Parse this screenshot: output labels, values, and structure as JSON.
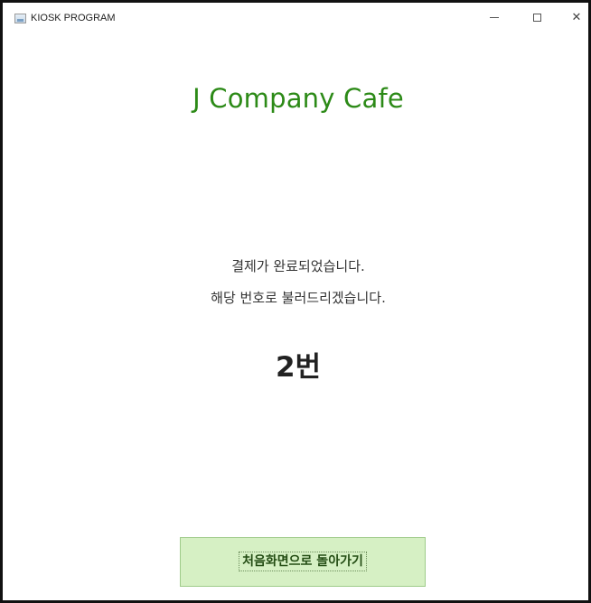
{
  "window": {
    "title": "KIOSK PROGRAM",
    "controls": {
      "minimize": "minimize",
      "maximize": "maximize",
      "close": "close"
    }
  },
  "header": {
    "cafe_name": "J Company Cafe"
  },
  "main": {
    "message_line1": "결제가 완료되었습니다.",
    "message_line2": "해당 번호로 불러드리겠습니다.",
    "order_number": "2번"
  },
  "footer": {
    "home_button_label": "처음화면으로 돌아가기"
  },
  "colors": {
    "title_green": "#2c8a17",
    "button_bg": "#d6f0c4",
    "button_border": "#9fcb8a",
    "text_dark": "#333333"
  },
  "icons": {
    "app": "java-app-icon",
    "minimize": "minimize-icon",
    "maximize": "maximize-icon",
    "close": "close-icon"
  }
}
